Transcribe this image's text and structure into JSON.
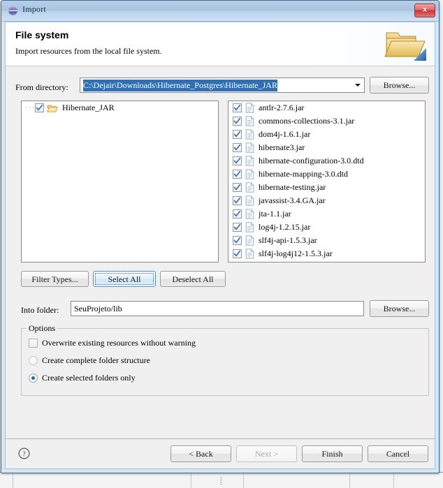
{
  "window": {
    "title": "Import",
    "icon": "eclipse-sphere-icon",
    "close_label": "x"
  },
  "header": {
    "title": "File system",
    "description": "Import resources from the local file system.",
    "icon": "open-folder-import-icon"
  },
  "source": {
    "label": "From directory:",
    "value": "C:\\Dejair\\Downloads\\Hibernate_Postgres\\Hibernate_JAR",
    "placeholder": "",
    "selected": true,
    "browse_label": "Browse..."
  },
  "tree": {
    "items": [
      {
        "label": "Hibernate_JAR",
        "checked": true,
        "icon": "open-folder-icon"
      }
    ]
  },
  "files": {
    "items": [
      {
        "name": "antlr-2.7.6.jar",
        "checked": true
      },
      {
        "name": "commons-collections-3.1.jar",
        "checked": true
      },
      {
        "name": "dom4j-1.6.1.jar",
        "checked": true
      },
      {
        "name": "hibernate3.jar",
        "checked": true
      },
      {
        "name": "hibernate-configuration-3.0.dtd",
        "checked": true
      },
      {
        "name": "hibernate-mapping-3.0.dtd",
        "checked": true
      },
      {
        "name": "hibernate-testing.jar",
        "checked": true
      },
      {
        "name": "javassist-3.4.GA.jar",
        "checked": true
      },
      {
        "name": "jta-1.1.jar",
        "checked": true
      },
      {
        "name": "log4j-1.2.15.jar",
        "checked": true
      },
      {
        "name": "slf4j-api-1.5.3.jar",
        "checked": true
      },
      {
        "name": "slf4j-log4j12-1.5.3.jar",
        "checked": true
      }
    ]
  },
  "selection_buttons": {
    "filter_types": "Filter Types...",
    "select_all": "Select All",
    "deselect_all": "Deselect All"
  },
  "destination": {
    "label": "Into folder:",
    "value": "SeuProjeto/lib",
    "browse_label": "Browse..."
  },
  "options": {
    "group_label": "Options",
    "overwrite": {
      "label": "Overwrite existing resources without warning",
      "checked": false
    },
    "folder_mode": {
      "complete": {
        "label": "Create complete folder structure",
        "selected": false
      },
      "selected_only": {
        "label": "Create selected folders only",
        "selected": true
      }
    }
  },
  "footer": {
    "help_icon": "help-question-icon",
    "back": {
      "label": "< Back",
      "enabled": true
    },
    "next": {
      "label": "Next >",
      "enabled": false
    },
    "finish": {
      "label": "Finish",
      "enabled": true
    },
    "cancel": {
      "label": "Cancel",
      "enabled": true
    }
  },
  "colors": {
    "titlebar": "#a9c4e0",
    "dialog_border": "#3c6f96",
    "selection_blue": "#2f6fb5",
    "close_red": "#c93434",
    "folder_yellow": "#f2cd72",
    "content_gray": "#f0f0f0"
  }
}
